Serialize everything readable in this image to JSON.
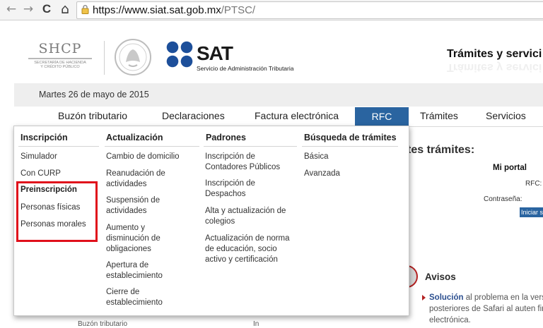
{
  "browser": {
    "back": "←",
    "forward": "→",
    "reload": "C",
    "home": "⌂",
    "url_domain": "https://www.siat.sat.gob.mx",
    "url_path": "/PTSC/"
  },
  "header": {
    "shcp_title": "SHCP",
    "shcp_line1": "SECRETARÍA DE HACIENDA",
    "shcp_line2": "Y CRÉDITO PÚBLICO",
    "sat_name": "SAT",
    "sat_full": "Servicio de Administración Tributaria",
    "right_title": "Trámites y servici"
  },
  "date": "Martes 26 de mayo de 2015",
  "nav": {
    "items": [
      "Buzón tributario",
      "Declaraciones",
      "Factura electrónica",
      "RFC",
      "Trámites",
      "Servicios"
    ],
    "active": "RFC"
  },
  "background": {
    "heading": "tes trámites:",
    "mi_portal": "Mi portal",
    "rfc_label": "RFC:",
    "pass_label": "Contraseña:",
    "login_button": "Iniciar s",
    "avisos_title": "Avisos",
    "aviso_bold": "Solución",
    "aviso_text": " al problema en la vers y posteriores de Safari al auten firma electrónica.",
    "bottom_left": "Buzón tributario",
    "bottom_mid": "In"
  },
  "dropdown": {
    "columns": [
      {
        "heading": "Inscripción",
        "links": [
          "Simulador",
          "Con CURP"
        ],
        "subheading": "Preinscripción",
        "sublinks": [
          "Personas físicas",
          "Personas morales"
        ]
      },
      {
        "heading": "Actualización",
        "links": [
          "Cambio de domicilio",
          "Reanudación de actividades",
          "Suspensión de actividades",
          "Aumento y disminución de obligaciones",
          "Apertura de establecimiento",
          "Cierre de establecimiento"
        ]
      },
      {
        "heading": "Padrones",
        "links": [
          "Inscripción de Contadores Públicos",
          "Inscripción de Despachos",
          "Alta y actualización de colegios",
          "Actualización de norma de educación, socio activo y certificación"
        ]
      },
      {
        "heading": "Búsqueda de trámites",
        "links": [
          "Básica",
          "Avanzada"
        ]
      }
    ]
  },
  "colors": {
    "accent_blue": "#2a64a0",
    "highlight_red": "#e0101b"
  }
}
